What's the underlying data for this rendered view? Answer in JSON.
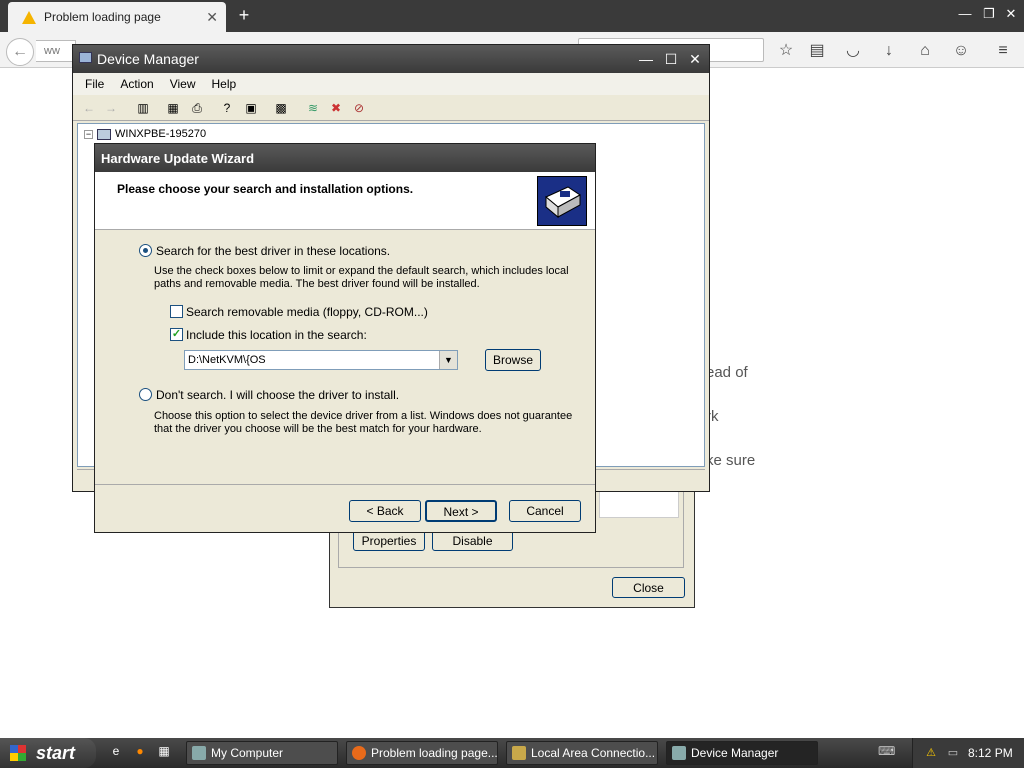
{
  "browser": {
    "tab_title": "Problem loading page",
    "url_fragment": "ww",
    "page_text": [
      "ead of",
      "rk",
      "ke sure"
    ]
  },
  "device_manager": {
    "title": "Device Manager",
    "menu": [
      "File",
      "Action",
      "View",
      "Help"
    ],
    "tree_root": "WINXPBE-195270"
  },
  "properties_dialog": {
    "properties_label": "Properties",
    "disable_label": "Disable",
    "close_label": "Close"
  },
  "wizard": {
    "title": "Hardware Update Wizard",
    "heading": "Please choose your search and installation options.",
    "option_search": "Search for the best driver in these locations.",
    "option_search_desc": "Use the check boxes below to limit or expand the default search, which includes local paths and removable media. The best driver found will be installed.",
    "check_removable": "Search removable media (floppy, CD-ROM...)",
    "check_removable_checked": false,
    "check_location": "Include this location in the search:",
    "check_location_checked": true,
    "path_value": "D:\\NetKVM\\{OS",
    "browse_label": "Browse",
    "option_dont": "Don't search. I will choose the driver to install.",
    "option_dont_desc": "Choose this option to select the device driver from a list.  Windows does not guarantee that the driver you choose will be the best match for your hardware.",
    "back_label": "< Back",
    "next_label": "Next >",
    "cancel_label": "Cancel",
    "selected_option": "search"
  },
  "taskbar": {
    "start_label": "start",
    "items": [
      {
        "label": "My Computer",
        "active": false
      },
      {
        "label": "Problem loading page...",
        "active": false
      },
      {
        "label": "Local Area Connectio...",
        "active": false
      },
      {
        "label": "Device Manager",
        "active": true
      }
    ],
    "clock": "8:12 PM"
  }
}
